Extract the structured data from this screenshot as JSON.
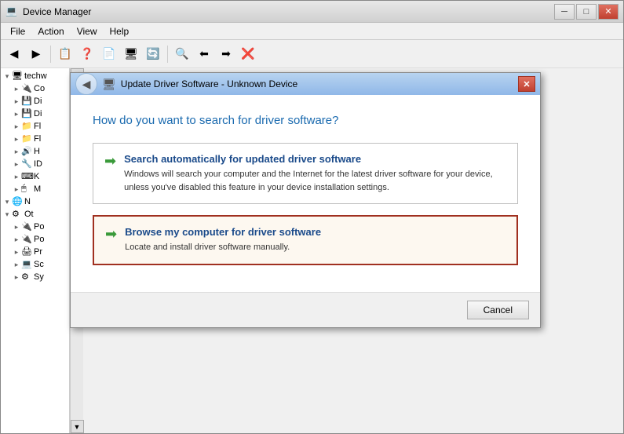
{
  "app": {
    "title": "Device Manager",
    "icon": "💻"
  },
  "titlebar": {
    "minimize_label": "─",
    "maximize_label": "□",
    "close_label": "✕"
  },
  "menubar": {
    "items": [
      "File",
      "Action",
      "View",
      "Help"
    ]
  },
  "toolbar": {
    "buttons": [
      "◀",
      "▶",
      "📋",
      "❓",
      "📄",
      "🖥",
      "🔄",
      "🔍",
      "⬅",
      "➡",
      "❌"
    ]
  },
  "tree": {
    "items": [
      {
        "label": "techw",
        "indent": 0,
        "expanded": true
      },
      {
        "label": "Co",
        "indent": 1
      },
      {
        "label": "Di",
        "indent": 1
      },
      {
        "label": "Di",
        "indent": 1
      },
      {
        "label": "Fl",
        "indent": 1
      },
      {
        "label": "Fl",
        "indent": 1
      },
      {
        "label": "H",
        "indent": 1
      },
      {
        "label": "ID",
        "indent": 1
      },
      {
        "label": "K",
        "indent": 1
      },
      {
        "label": "M",
        "indent": 1
      },
      {
        "label": "N",
        "indent": 0,
        "expanded": true
      },
      {
        "label": "Ot",
        "indent": 0,
        "expanded": true
      },
      {
        "label": "Po",
        "indent": 1
      },
      {
        "label": "Po",
        "indent": 1
      },
      {
        "label": "Pr",
        "indent": 1
      },
      {
        "label": "Sc",
        "indent": 1
      },
      {
        "label": "Sy",
        "indent": 1
      }
    ]
  },
  "dialog": {
    "title": "Update Driver Software - Unknown Device",
    "title_icon": "🖥",
    "close_label": "✕",
    "question": "How do you want to search for driver software?",
    "option1": {
      "title": "Search automatically for updated driver software",
      "desc": "Windows will search your computer and the Internet for the latest driver software\nfor your device, unless you've disabled this feature in your device installation\nsettings."
    },
    "option2": {
      "title": "Browse my computer for driver software",
      "desc": "Locate and install driver software manually."
    },
    "cancel_label": "Cancel"
  }
}
